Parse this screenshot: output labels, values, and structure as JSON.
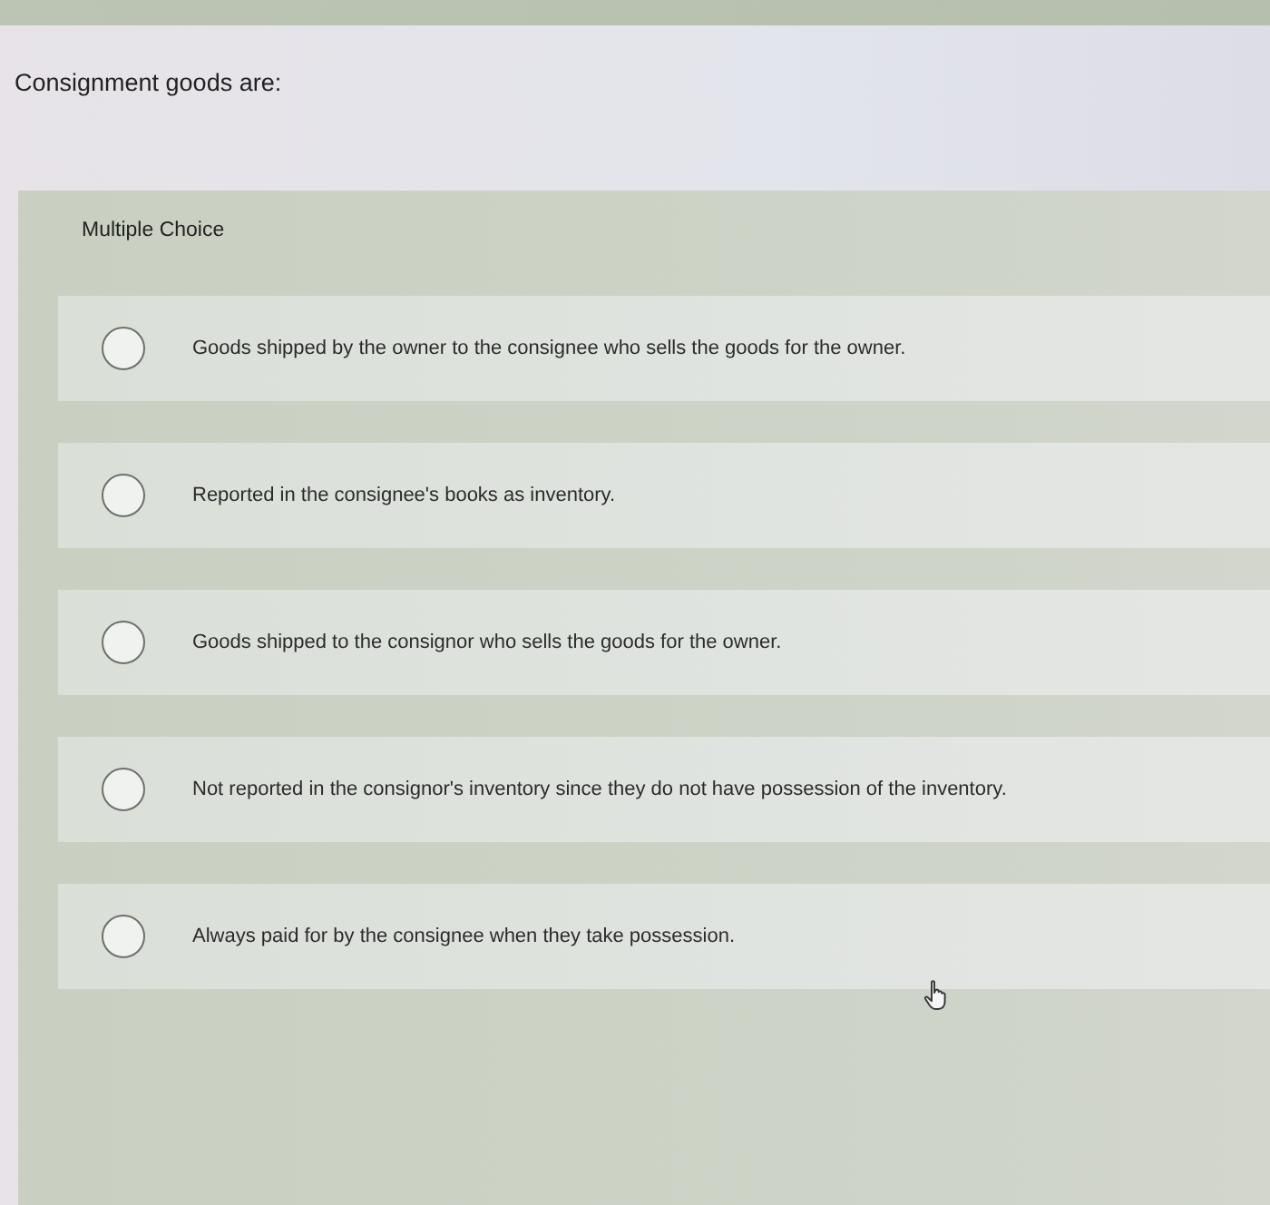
{
  "question": {
    "text": "Consignment goods are:"
  },
  "card": {
    "label": "Multiple Choice",
    "options": [
      {
        "text": "Goods shipped by the owner to the consignee who sells the goods for the owner.",
        "selected": false
      },
      {
        "text": "Reported in the consignee's books as inventory.",
        "selected": false
      },
      {
        "text": "Goods shipped to the consignor who sells the goods for the owner.",
        "selected": false
      },
      {
        "text": "Not reported in the consignor's inventory since they do not have possession of the inventory.",
        "selected": false
      },
      {
        "text": "Always paid for by the consignee when they take possession.",
        "selected": false
      }
    ]
  }
}
